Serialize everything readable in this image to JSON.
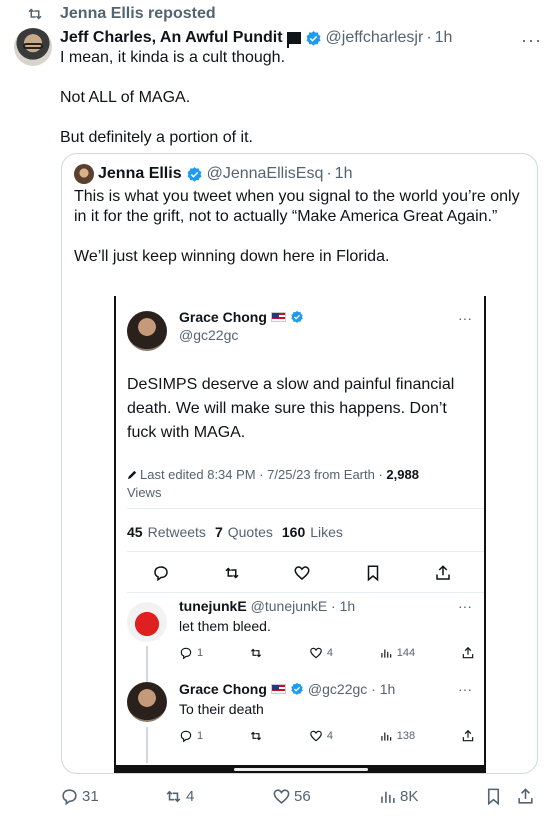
{
  "repost": {
    "label": "Jenna Ellis reposted"
  },
  "post": {
    "author_name": "Jeff Charles, An Awful Pundit",
    "handle": "@jeffcharlesjr",
    "separator": "·",
    "time": "1h",
    "more": "···",
    "lines": [
      "I mean, it kinda is a cult though.",
      "Not ALL of MAGA.",
      "But definitely a portion of it."
    ],
    "actions": {
      "replies": "31",
      "reposts": "4",
      "likes": "56",
      "views": "8K"
    }
  },
  "quote": {
    "author_name": "Jenna Ellis",
    "handle": "@JennaEllisEsq",
    "separator": "·",
    "time": "1h",
    "paragraph1": "This is what you tweet when you signal to the world you’re only in it for the grift, not to actually “Make America Great Again.”",
    "paragraph2": "We’ll just keep winning down here in Florida."
  },
  "screenshot": {
    "author_name": "Grace Chong",
    "handle": "@gc22gc",
    "more": "···",
    "text": "DeSIMPS  deserve a slow and painful financial death. We will make sure this happens. Don’t fuck with MAGA.",
    "edited_prefix": "Last edited 8:34 PM · 7/25/23  from Earth · ",
    "views_count": "2,988",
    "views_label": "Views",
    "retweets_count": "45",
    "retweets_label": "Retweets",
    "quotes_count": "7",
    "quotes_label": "Quotes",
    "likes_count": "160",
    "likes_label": "Likes",
    "replies": [
      {
        "author_name": "tunejunkE",
        "handle": "@tunejunkE · 1h",
        "text": "let them bleed.",
        "more": "···",
        "comments": "1",
        "likes": "4",
        "views": "144"
      },
      {
        "author_name": "Grace Chong",
        "handle": "@gc22gc · 1h",
        "text": "To their death",
        "more": "···",
        "comments": "1",
        "likes": "4",
        "views": "138"
      }
    ]
  },
  "icons": {
    "repost": "repost-icon",
    "verified": "verified-badge-icon",
    "reply": "reply-icon",
    "like": "heart-icon",
    "views": "views-chart-icon",
    "bookmark": "bookmark-icon",
    "share": "share-icon"
  },
  "colors": {
    "verified": "#1d9bf0",
    "muted": "#536471",
    "text": "#0f1419",
    "border": "#cfd9de"
  }
}
